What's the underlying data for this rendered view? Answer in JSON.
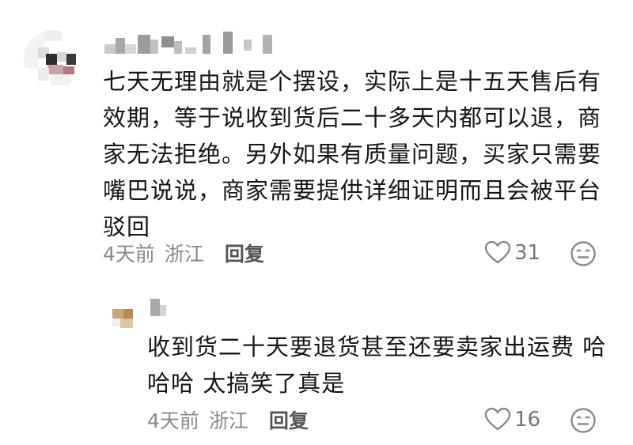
{
  "comment": {
    "text": "七天无理由就是个摆设，实际上是十五天售后有效期，等于说收到货后二十多天内都可以退，商家无法拒绝。另外如果有质量问题，买家只需要嘴巴说说，商家需要提供详细证明而且会被平台驳回",
    "time": "4天前",
    "location": "浙江",
    "reply_label": "回复",
    "like_count": "31",
    "icons": {
      "like": "heart-outline-icon",
      "emoji": "neutral-face-icon"
    }
  },
  "reply": {
    "text": "收到货二十天要退货甚至还要卖家出运费 哈哈哈 太搞笑了真是",
    "time": "4天前",
    "location": "浙江",
    "reply_label": "回复",
    "like_count": "16",
    "icons": {
      "like": "heart-outline-icon",
      "emoji": "neutral-face-icon"
    }
  },
  "colors": {
    "text_primary": "#161616",
    "text_meta": "#8a8a8a",
    "reply_button": "#555555",
    "like_count": "#777777",
    "icon_stroke": "#8a8a8a"
  }
}
